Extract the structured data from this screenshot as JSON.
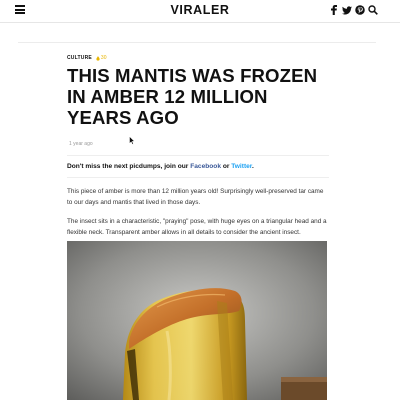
{
  "header": {
    "logo": "VIRALER",
    "icons": [
      "menu-icon",
      "facebook-icon",
      "twitter-icon",
      "pinterest-icon",
      "search-icon"
    ]
  },
  "article": {
    "category": "CULTURE",
    "hot_badge": "30",
    "title": "THIS MANTIS WAS FROZEN IN AMBER 12 MILLION YEARS AGO",
    "time": "1 year ago",
    "lead_prefix": "Don't miss the next picdumps, join our ",
    "lead_facebook": "Facebook",
    "lead_or": " or ",
    "lead_twitter": "Twitter",
    "lead_suffix": ".",
    "paragraphs": [
      "This piece of amber is more than 12 million years old! Surprisingly well-preserved tar came to our days and mantis that lived in those days.",
      "The insect sits in a characteristic, \"praying\" pose, with huge eyes on a triangular head and a flexible neck. Transparent amber allows in all details to consider the ancient insect."
    ]
  },
  "colors": {
    "facebook_link": "#3b5998",
    "twitter_link": "#1da1f2",
    "hot_badge": "#e8b500",
    "amber": "#e0b21c"
  }
}
